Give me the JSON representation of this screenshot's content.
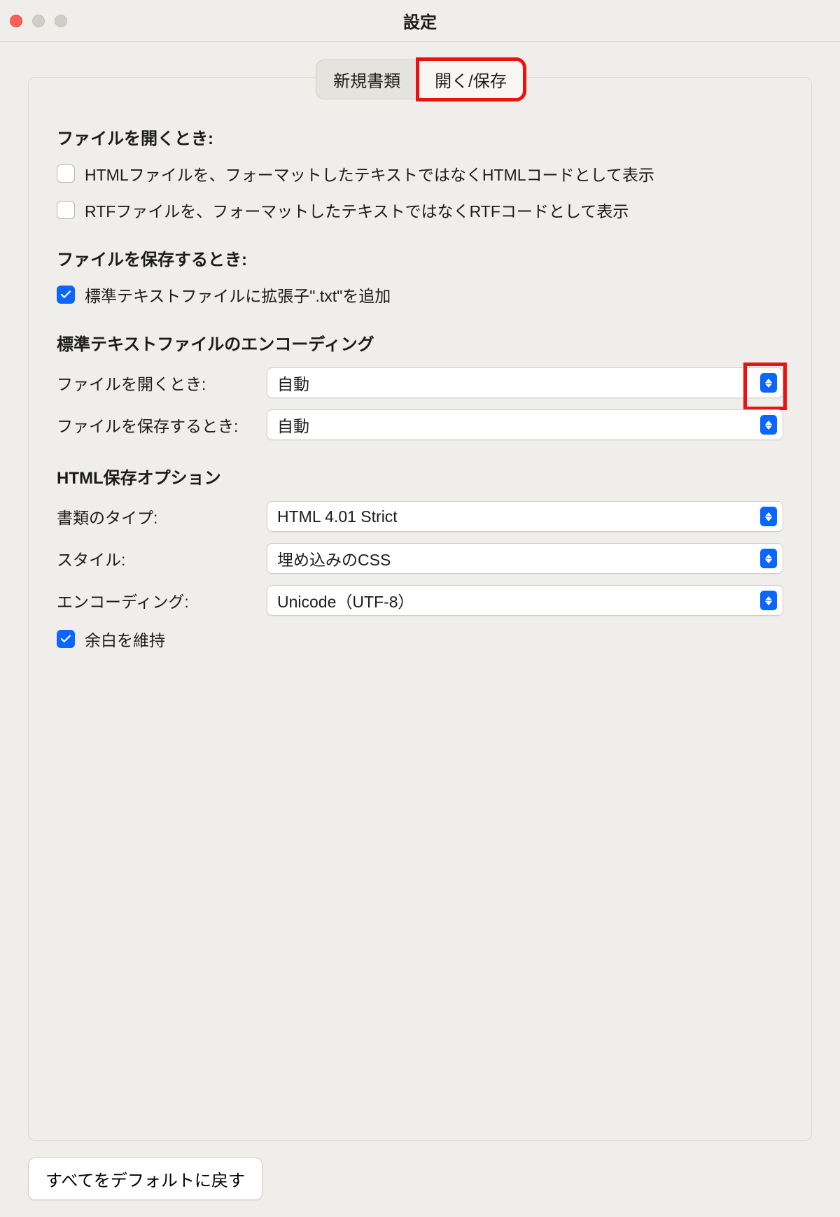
{
  "window": {
    "title": "設定"
  },
  "tabs": {
    "new_doc": "新規書類",
    "open_save": "開く/保存"
  },
  "open_section": {
    "title": "ファイルを開くとき:",
    "html_as_code": "HTMLファイルを、フォーマットしたテキストではなくHTMLコードとして表示",
    "rtf_as_code": "RTFファイルを、フォーマットしたテキストではなくRTFコードとして表示"
  },
  "save_section": {
    "title": "ファイルを保存するとき:",
    "add_txt": "標準テキストファイルに拡張子\".txt\"を追加"
  },
  "encoding_section": {
    "title": "標準テキストファイルのエンコーディング",
    "open_label": "ファイルを開くとき:",
    "open_value": "自動",
    "save_label": "ファイルを保存するとき:",
    "save_value": "自動"
  },
  "html_section": {
    "title": "HTML保存オプション",
    "doc_type_label": "書類のタイプ:",
    "doc_type_value": "HTML 4.01 Strict",
    "style_label": "スタイル:",
    "style_value": "埋め込みのCSS",
    "encoding_label": "エンコーディング:",
    "encoding_value": "Unicode（UTF-8）",
    "preserve_ws": "余白を維持"
  },
  "footer": {
    "reset": "すべてをデフォルトに戻す"
  }
}
